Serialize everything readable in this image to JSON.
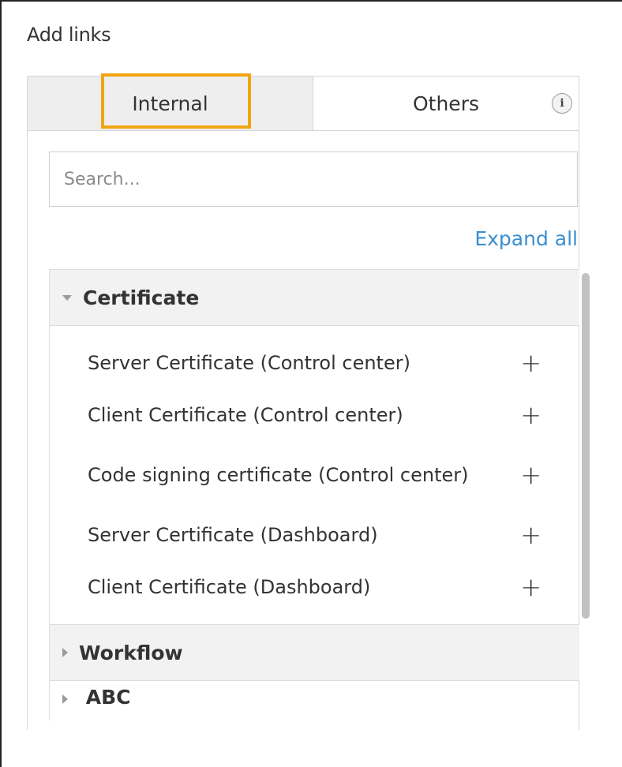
{
  "panel": {
    "title": "Add links"
  },
  "tabs": [
    {
      "label": "Internal",
      "active": true
    },
    {
      "label": "Others",
      "active": false
    }
  ],
  "search": {
    "placeholder": "Search...",
    "value": ""
  },
  "expand_all": "Expand all",
  "groups": [
    {
      "label": "Certificate",
      "expanded": true,
      "items": [
        "Server Certificate (Control center)",
        "Client Certificate (Control center)",
        "Code signing certificate (Control center)",
        "Server Certificate (Dashboard)",
        "Client Certificate (Dashboard)"
      ]
    },
    {
      "label": "Workflow",
      "expanded": false
    },
    {
      "label": "ABC",
      "expanded": false
    }
  ],
  "icons": {
    "info": "info-icon",
    "add": "plus-icon",
    "expanded": "caret-down-icon",
    "collapsed": "caret-right-icon"
  },
  "colors": {
    "highlight": "#f2a512",
    "link": "#3a8fd1"
  }
}
